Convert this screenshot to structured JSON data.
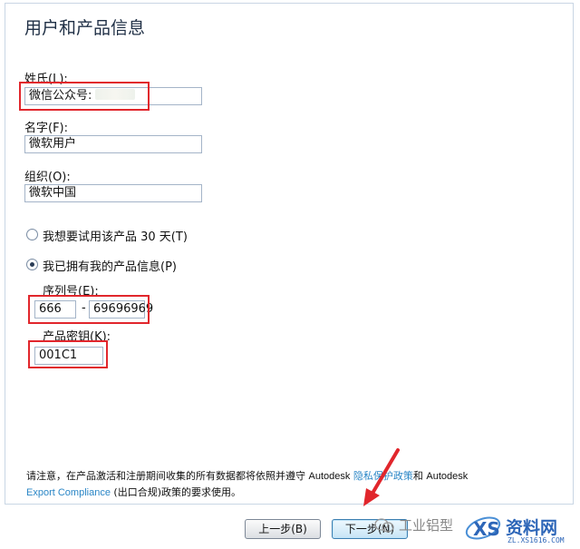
{
  "dialog": {
    "title": "用户和产品信息"
  },
  "form": {
    "last_name": {
      "label": "姓氏(L):",
      "value": "微信公众号:"
    },
    "first_name": {
      "label": "名字(F):",
      "value": "微软用户"
    },
    "organization": {
      "label": "组织(O):",
      "value": "微软中国"
    },
    "trial_option": {
      "label": "我想要试用该产品 30 天(T)",
      "selected": false
    },
    "owned_option": {
      "label": "我已拥有我的产品信息(P)",
      "selected": true
    },
    "serial": {
      "label": "序列号(E):",
      "prefix": "666",
      "separator": "-",
      "value": "69696969"
    },
    "product_key": {
      "label": "产品密钥(K):",
      "value": "001C1"
    }
  },
  "notice": {
    "part1": "请注意，在产品激活和注册期间收集的所有数据都将依照并遵守 ",
    "brand1": "Autodesk",
    "link1": "隐私保护政策",
    "part2": "和 ",
    "brand2": "Autodesk",
    "link2": "Export Compliance",
    "part3": " (出口合规)政策的要求使用。"
  },
  "buttons": {
    "back": "上一步(B)",
    "next": "下一步(N)"
  },
  "watermarks": {
    "wechat": "工业铝型",
    "site": "资料网",
    "site_url": "ZL.XS1616.COM"
  },
  "colors": {
    "highlight": "#e1262c",
    "link": "#2a86c6",
    "arrow": "#e1262c"
  }
}
